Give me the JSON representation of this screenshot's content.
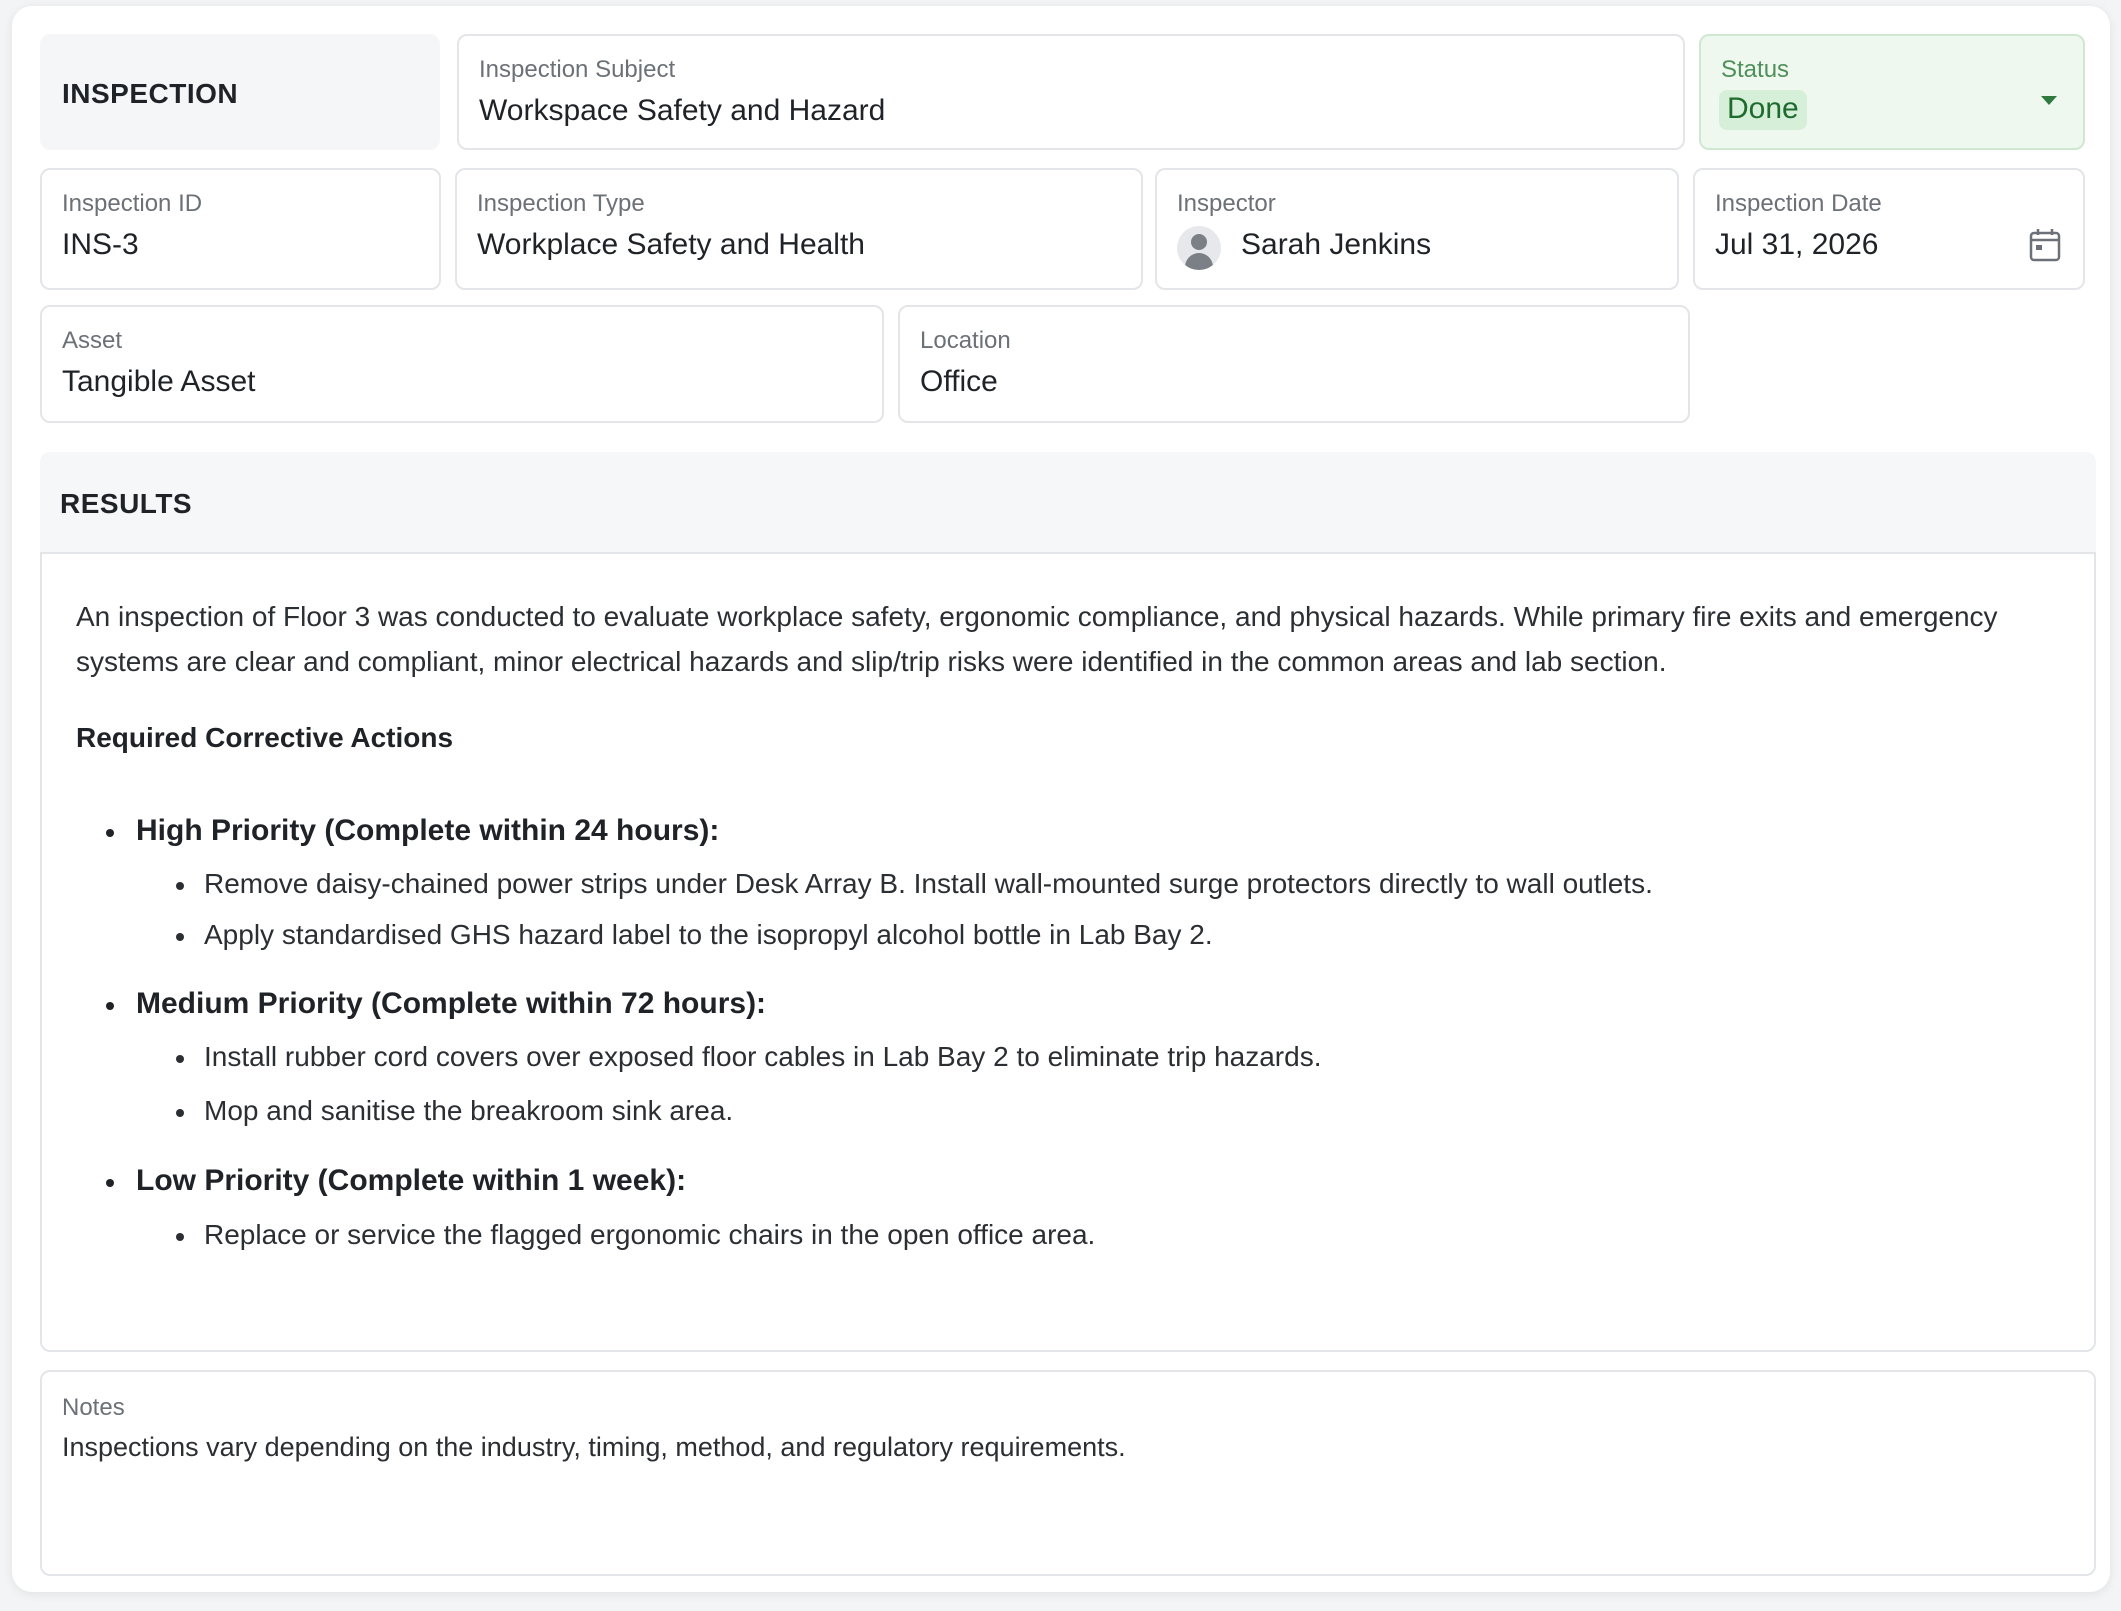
{
  "header": {
    "title": "INSPECTION"
  },
  "fields": {
    "subject": {
      "label": "Inspection Subject",
      "value": "Workspace Safety and Hazard"
    },
    "status": {
      "label": "Status",
      "value": "Done"
    },
    "id": {
      "label": "Inspection ID",
      "value": "INS-3"
    },
    "type": {
      "label": "Inspection Type",
      "value": "Workplace Safety and Health"
    },
    "inspector": {
      "label": "Inspector",
      "value": "Sarah Jenkins"
    },
    "date": {
      "label": "Inspection Date",
      "value": "Jul 31, 2026"
    },
    "asset": {
      "label": "Asset",
      "value": "Tangible Asset"
    },
    "location": {
      "label": "Location",
      "value": "Office"
    }
  },
  "results": {
    "title": "RESULTS",
    "summary": "An inspection of Floor 3 was conducted to evaluate workplace safety, ergonomic compliance, and physical hazards. While primary fire exits and emergency systems are clear and compliant, minor electrical hazards and slip/trip risks were identified in the common areas and lab section.",
    "actions_title": "Required Corrective Actions",
    "priorities": [
      {
        "title": "High Priority (Complete within 24 hours):",
        "items": [
          "Remove daisy-chained power strips under Desk Array B. Install wall-mounted surge protectors directly to wall outlets.",
          "Apply standardised GHS hazard label to the isopropyl alcohol bottle in Lab Bay 2."
        ]
      },
      {
        "title": "Medium Priority (Complete within 72 hours):",
        "items": [
          "Install rubber cord covers over exposed floor cables in Lab Bay 2 to eliminate trip hazards.",
          "Mop and sanitise the breakroom sink area."
        ]
      },
      {
        "title": "Low Priority (Complete within 1 week):",
        "items": [
          "Replace or service the flagged ergonomic chairs in the open office area."
        ]
      }
    ]
  },
  "notes": {
    "label": "Notes",
    "value": "Inspections vary depending on the industry, timing, method, and regulatory requirements."
  },
  "colors": {
    "status_bg": "#eef8ef",
    "status_text": "#1e6b2e",
    "border": "#e3e5e8"
  },
  "icons": {
    "status_caret": "chevron-down-icon",
    "inspector_avatar": "user-avatar-icon",
    "date_picker": "calendar-icon"
  }
}
